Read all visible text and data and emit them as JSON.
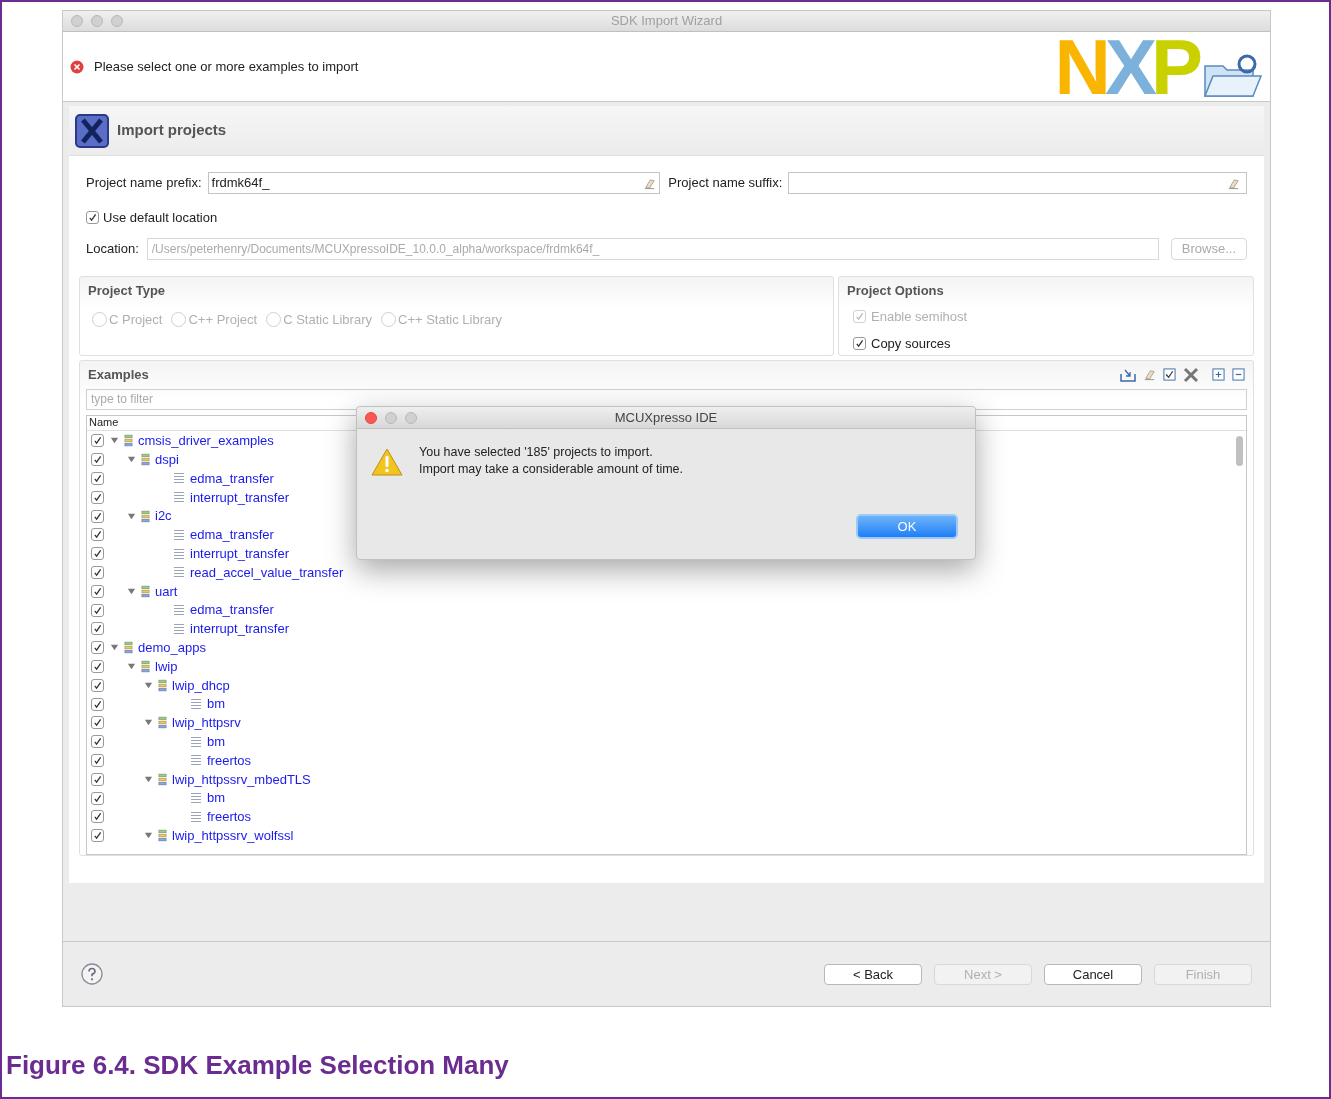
{
  "window": {
    "title": "SDK Import Wizard"
  },
  "message": {
    "kind": "error",
    "text": "Please select one or more examples to import"
  },
  "logo": {
    "text": "NXP"
  },
  "page_title": "Import projects",
  "prefix": {
    "label": "Project name prefix:",
    "value": "frdmk64f_"
  },
  "suffix": {
    "label": "Project name suffix:"
  },
  "use_default_location": {
    "label": "Use default location",
    "checked": true
  },
  "location": {
    "label": "Location:",
    "value": "/Users/peterhenry/Documents/MCUXpressoIDE_10.0.0_alpha/workspace/frdmk64f_",
    "disabled": true
  },
  "browse_button": {
    "label": "Browse...",
    "disabled": true
  },
  "project_type": {
    "title": "Project Type",
    "options": [
      {
        "label": "C Project",
        "selected": false,
        "disabled": true
      },
      {
        "label": "C++ Project",
        "selected": false,
        "disabled": true
      },
      {
        "label": "C Static Library",
        "selected": false,
        "disabled": true
      },
      {
        "label": "C++ Static Library",
        "selected": false,
        "disabled": true
      }
    ]
  },
  "project_options": {
    "title": "Project Options",
    "options": [
      {
        "label": "Enable semihost",
        "checked": true,
        "disabled": true
      },
      {
        "label": "Copy sources",
        "checked": true,
        "disabled": false
      }
    ]
  },
  "examples": {
    "title": "Examples",
    "filter_placeholder": "type to filter",
    "column": "Name",
    "tree": [
      {
        "name": "cmsis_driver_examples",
        "kind": "group",
        "checked": true,
        "expanded": true,
        "children": [
          {
            "name": "dspi",
            "kind": "group",
            "checked": true,
            "expanded": true,
            "children": [
              {
                "name": "edma_transfer",
                "kind": "project",
                "checked": true
              },
              {
                "name": "interrupt_transfer",
                "kind": "project",
                "checked": true
              }
            ]
          },
          {
            "name": "i2c",
            "kind": "group",
            "checked": true,
            "expanded": true,
            "children": [
              {
                "name": "edma_transfer",
                "kind": "project",
                "checked": true
              },
              {
                "name": "interrupt_transfer",
                "kind": "project",
                "checked": true
              },
              {
                "name": "read_accel_value_transfer",
                "kind": "project",
                "checked": true
              }
            ]
          },
          {
            "name": "uart",
            "kind": "group",
            "checked": true,
            "expanded": true,
            "children": [
              {
                "name": "edma_transfer",
                "kind": "project",
                "checked": true
              },
              {
                "name": "interrupt_transfer",
                "kind": "project",
                "checked": true
              }
            ]
          }
        ]
      },
      {
        "name": "demo_apps",
        "kind": "group",
        "checked": true,
        "expanded": true,
        "children": [
          {
            "name": "lwip",
            "kind": "group",
            "checked": true,
            "expanded": true,
            "children": [
              {
                "name": "lwip_dhcp",
                "kind": "group",
                "checked": true,
                "expanded": true,
                "children": [
                  {
                    "name": "bm",
                    "kind": "project",
                    "checked": true
                  }
                ]
              },
              {
                "name": "lwip_httpsrv",
                "kind": "group",
                "checked": true,
                "expanded": true,
                "children": [
                  {
                    "name": "bm",
                    "kind": "project",
                    "checked": true
                  },
                  {
                    "name": "freertos",
                    "kind": "project",
                    "checked": true
                  }
                ]
              },
              {
                "name": "lwip_httpssrv_mbedTLS",
                "kind": "group",
                "checked": true,
                "expanded": true,
                "children": [
                  {
                    "name": "bm",
                    "kind": "project",
                    "checked": true
                  },
                  {
                    "name": "freertos",
                    "kind": "project",
                    "checked": true
                  }
                ]
              },
              {
                "name": "lwip_httpssrv_wolfssl",
                "kind": "group",
                "checked": true,
                "expanded": true
              }
            ]
          }
        ]
      }
    ]
  },
  "buttons": [
    {
      "label": "< Back",
      "disabled": false
    },
    {
      "label": "Next >",
      "disabled": true
    },
    {
      "label": "Cancel",
      "disabled": false
    },
    {
      "label": "Finish",
      "disabled": true
    }
  ],
  "dialog": {
    "title": "MCUXpresso IDE",
    "kind": "warning",
    "lines": [
      "You have selected '185' projects to import.",
      "Import may take a considerable amount of time."
    ],
    "button": "OK"
  },
  "caption": "Figure 6.4. SDK Example Selection Many"
}
